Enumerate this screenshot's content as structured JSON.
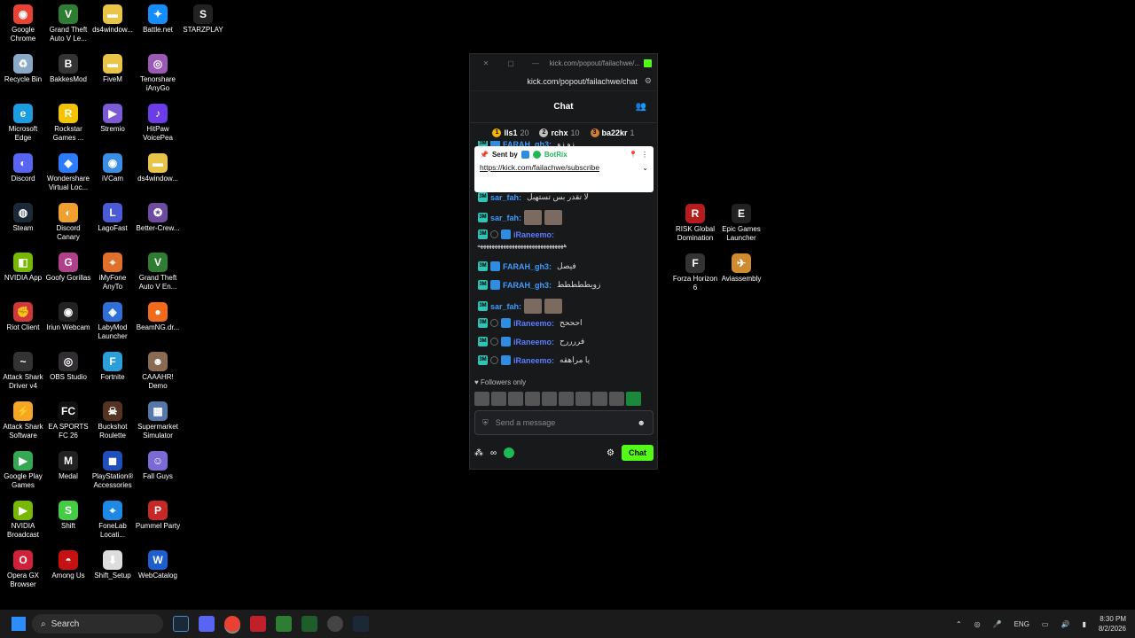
{
  "desktop_icons": [
    {
      "label": "Google Chrome",
      "color": "#e94235",
      "glyph": "◉"
    },
    {
      "label": "Grand Theft Auto V Le...",
      "color": "#2e7d32",
      "glyph": "V"
    },
    {
      "label": "ds4window...",
      "color": "#e8c547",
      "glyph": "▬"
    },
    {
      "label": "Battle.net",
      "color": "#148eff",
      "glyph": "✦"
    },
    {
      "label": "STARZPLAY",
      "color": "#222222",
      "glyph": "S"
    },
    {
      "label": "Recycle Bin",
      "color": "#8aa9c7",
      "glyph": "♻"
    },
    {
      "label": "BakkesMod",
      "color": "#333333",
      "glyph": "B"
    },
    {
      "label": "FiveM",
      "color": "#e8c547",
      "glyph": "▬"
    },
    {
      "label": "Tenorshare iAnyGo",
      "color": "#9b59b6",
      "glyph": "◎"
    },
    {
      "label": "Microsoft Edge",
      "color": "#1b9de2",
      "glyph": "e"
    },
    {
      "label": "Rockstar Games ...",
      "color": "#f5c400",
      "glyph": "R"
    },
    {
      "label": "Stremio",
      "color": "#7b5bd6",
      "glyph": "▶"
    },
    {
      "label": "HitPaw VoicePea",
      "color": "#6a3de8",
      "glyph": "♪"
    },
    {
      "label": "Discord",
      "color": "#5865f2",
      "glyph": "◐"
    },
    {
      "label": "Wondershare Virtual Loc...",
      "color": "#2b7cff",
      "glyph": "◆"
    },
    {
      "label": "iVCam",
      "color": "#3a8ee6",
      "glyph": "◉"
    },
    {
      "label": "ds4window...",
      "color": "#e8c547",
      "glyph": "▬"
    },
    {
      "label": "Steam",
      "color": "#1b2838",
      "glyph": "◍"
    },
    {
      "label": "Discord Canary",
      "color": "#f0a030",
      "glyph": "◐"
    },
    {
      "label": "LagoFast",
      "color": "#4b5bd6",
      "glyph": "L"
    },
    {
      "label": "Better-Crew...",
      "color": "#6d4ba0",
      "glyph": "✪"
    },
    {
      "label": "NVIDIA App",
      "color": "#76b900",
      "glyph": "◧"
    },
    {
      "label": "Goofy Gorillas",
      "color": "#b0408a",
      "glyph": "G"
    },
    {
      "label": "iMyFone AnyTo",
      "color": "#e0702a",
      "glyph": "⌖"
    },
    {
      "label": "Grand Theft Auto V En...",
      "color": "#2e7d32",
      "glyph": "V"
    },
    {
      "label": "Riot Client",
      "color": "#d13639",
      "glyph": "✊"
    },
    {
      "label": "Iriun Webcam",
      "color": "#222222",
      "glyph": "◉"
    },
    {
      "label": "LabyMod Launcher",
      "color": "#2f6fd6",
      "glyph": "◈"
    },
    {
      "label": "BeamNG.dr...",
      "color": "#f26a1b",
      "glyph": "●"
    },
    {
      "label": "Attack Shark Driver v4",
      "color": "#333333",
      "glyph": "~"
    },
    {
      "label": "OBS Studio",
      "color": "#302e31",
      "glyph": "◎"
    },
    {
      "label": "Fortnite",
      "color": "#2a9fd8",
      "glyph": "F"
    },
    {
      "label": "CAAAHR! Demo",
      "color": "#8a6a50",
      "glyph": "☻"
    },
    {
      "label": "Attack Shark Software",
      "color": "#f5a623",
      "glyph": "⚡"
    },
    {
      "label": "EA SPORTS FC 26",
      "color": "#111111",
      "glyph": "FC"
    },
    {
      "label": "Buckshot Roulette",
      "color": "#553322",
      "glyph": "☠"
    },
    {
      "label": "Supermarket Simulator",
      "color": "#5577aa",
      "glyph": "▦"
    },
    {
      "label": "Google Play Games",
      "color": "#34a853",
      "glyph": "▶"
    },
    {
      "label": "Medal",
      "color": "#222222",
      "glyph": "M"
    },
    {
      "label": "PlayStation® Accessories",
      "color": "#1f4fbf",
      "glyph": "◼"
    },
    {
      "label": "Fall Guys",
      "color": "#7b6ad6",
      "glyph": "☺"
    },
    {
      "label": "NVIDIA Broadcast",
      "color": "#76b900",
      "glyph": "▶"
    },
    {
      "label": "Shift",
      "color": "#44cc44",
      "glyph": "S"
    },
    {
      "label": "FoneLab Locati...",
      "color": "#1e88e5",
      "glyph": "⌖"
    },
    {
      "label": "Pummel Party",
      "color": "#c62828",
      "glyph": "P"
    },
    {
      "label": "Opera GX Browser",
      "color": "#d0203a",
      "glyph": "O"
    },
    {
      "label": "Among Us",
      "color": "#c51111",
      "glyph": "◓"
    },
    {
      "label": "Shift_Setup",
      "color": "#dddddd",
      "glyph": "⬇"
    },
    {
      "label": "WebCatalog",
      "color": "#1e5fcf",
      "glyph": "W"
    },
    {
      "label": "RISK Global Domination",
      "color": "#b71c1c",
      "glyph": "R"
    },
    {
      "label": "Epic Games Launcher",
      "color": "#222222",
      "glyph": "E"
    },
    {
      "label": "Forza Horizon 6",
      "color": "#333333",
      "glyph": "F"
    },
    {
      "label": "Aviassembly",
      "color": "#d08a30",
      "glyph": "✈"
    }
  ],
  "popup": {
    "window_title": "kick.com/popout/failachwe/...",
    "url": "kick.com/popout/failachwe/chat",
    "chat_title": "Chat",
    "leaderboard": [
      {
        "rank": "1",
        "name": "lls1",
        "count": "20",
        "color": "#f4b400"
      },
      {
        "rank": "2",
        "name": "rchx",
        "count": "10",
        "color": "#c0c0c0"
      },
      {
        "rank": "3",
        "name": "ba22kr",
        "count": "1",
        "color": "#cd7f32"
      }
    ],
    "pinned": {
      "sent_by": "Sent by",
      "sender": "BotRix",
      "link": "https://kick.com/failachwe/subscribe"
    },
    "messages": [
      {
        "user": "FARAH_gh3",
        "text": "زو زو",
        "color": "#3d9bff",
        "badges": [
          "green",
          "blue"
        ],
        "emote": false
      },
      {
        "user": "sar_fah",
        "text": "لا تقدر بس تستهبل",
        "color": "#3d9bff",
        "badges": [
          "green"
        ],
        "emote": false
      },
      {
        "user": "sar_fah",
        "text": "",
        "color": "#3d9bff",
        "badges": [
          "green"
        ],
        "emote": true
      },
      {
        "user": "iRaneemo",
        "text": "ههههههههههههههههههههههههههههههه",
        "color": "#5b7cff",
        "badges": [
          "green",
          "dot",
          "blue"
        ],
        "emote": false
      },
      {
        "user": "FARAH_gh3",
        "text": "فيصل",
        "color": "#3d9bff",
        "badges": [
          "green",
          "blue"
        ],
        "emote": false
      },
      {
        "user": "FARAH_gh3",
        "text": "زويططططط",
        "color": "#3d9bff",
        "badges": [
          "green",
          "blue"
        ],
        "emote": false
      },
      {
        "user": "sar_fah",
        "text": "",
        "color": "#3d9bff",
        "badges": [
          "green"
        ],
        "emote": true
      },
      {
        "user": "iRaneemo",
        "text": "احححح",
        "color": "#5b7cff",
        "badges": [
          "green",
          "dot",
          "blue"
        ],
        "emote": false
      },
      {
        "user": "iRaneemo",
        "text": "فررررح",
        "color": "#5b7cff",
        "badges": [
          "green",
          "dot",
          "blue"
        ],
        "emote": false
      },
      {
        "user": "iRaneemo",
        "text": "يا مراهقه",
        "color": "#5b7cff",
        "badges": [
          "green",
          "dot",
          "blue"
        ],
        "emote": false
      }
    ],
    "followers_only": "Followers only",
    "input_placeholder": "Send a message",
    "chat_button": "Chat",
    "accent": "#53fc18"
  },
  "taskbar": {
    "search_label": "Search",
    "language": "ENG",
    "time": "8:30 PM",
    "date": "8/2/2026"
  }
}
